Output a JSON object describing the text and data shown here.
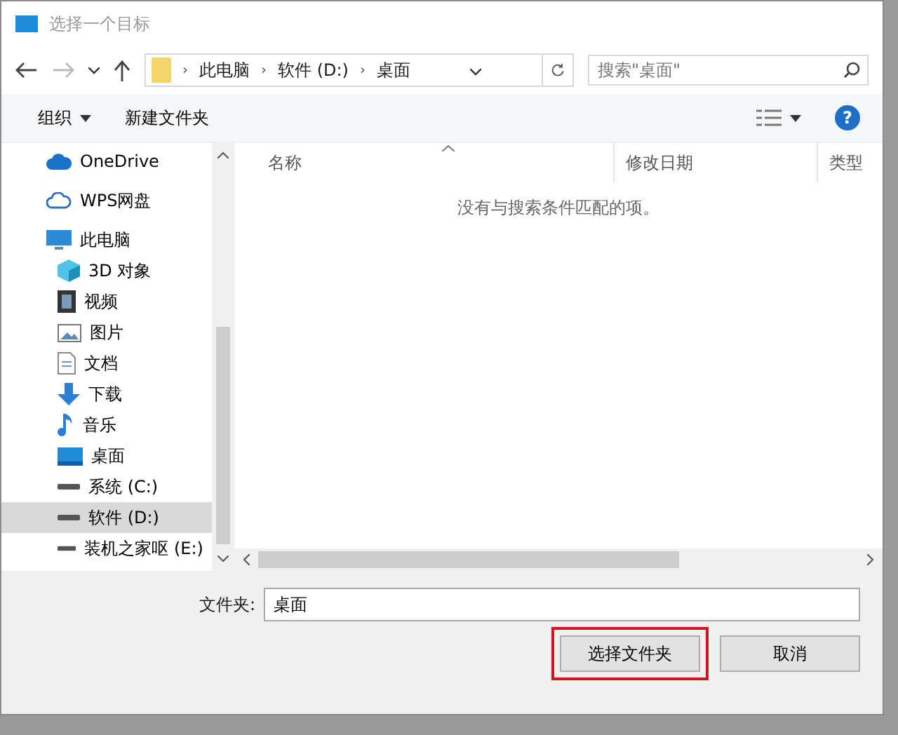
{
  "window": {
    "title": "选择一个目标"
  },
  "navigation": {
    "back_disabled": false,
    "forward_disabled": true
  },
  "address_bar": {
    "separator": "›",
    "crumbs": [
      "此电脑",
      "软件 (D:)",
      "桌面"
    ]
  },
  "search": {
    "placeholder": "搜索\"桌面\""
  },
  "toolbar": {
    "organize": "组织",
    "new_folder": "新建文件夹",
    "help": "?"
  },
  "sidebar": {
    "items": [
      {
        "label": "OneDrive",
        "kind": "cloud",
        "selected": false
      },
      {
        "label": "WPS网盘",
        "kind": "cloud-outline",
        "selected": false
      },
      {
        "label": "此电脑",
        "kind": "computer",
        "selected": false,
        "children": [
          {
            "label": "3D 对象",
            "kind": "cube",
            "selected": false
          },
          {
            "label": "视频",
            "kind": "film",
            "selected": false
          },
          {
            "label": "图片",
            "kind": "picture",
            "selected": false
          },
          {
            "label": "文档",
            "kind": "document",
            "selected": false
          },
          {
            "label": "下载",
            "kind": "download",
            "selected": false
          },
          {
            "label": "音乐",
            "kind": "music",
            "selected": false
          },
          {
            "label": "桌面",
            "kind": "desktop",
            "selected": false
          },
          {
            "label": "系统 (C:)",
            "kind": "drive",
            "selected": false
          },
          {
            "label": "软件 (D:)",
            "kind": "drive",
            "selected": true
          },
          {
            "label": "装机之家呕 (E:)",
            "kind": "drive",
            "selected": false
          }
        ]
      }
    ]
  },
  "table": {
    "columns": [
      "名称",
      "修改日期",
      "类型"
    ],
    "empty_message": "没有与搜索条件匹配的项。"
  },
  "folder_field": {
    "label": "文件夹:",
    "value": "桌面"
  },
  "buttons": [
    {
      "label": "选择文件夹",
      "highlighted": true
    },
    {
      "label": "取消",
      "highlighted": false
    }
  ]
}
